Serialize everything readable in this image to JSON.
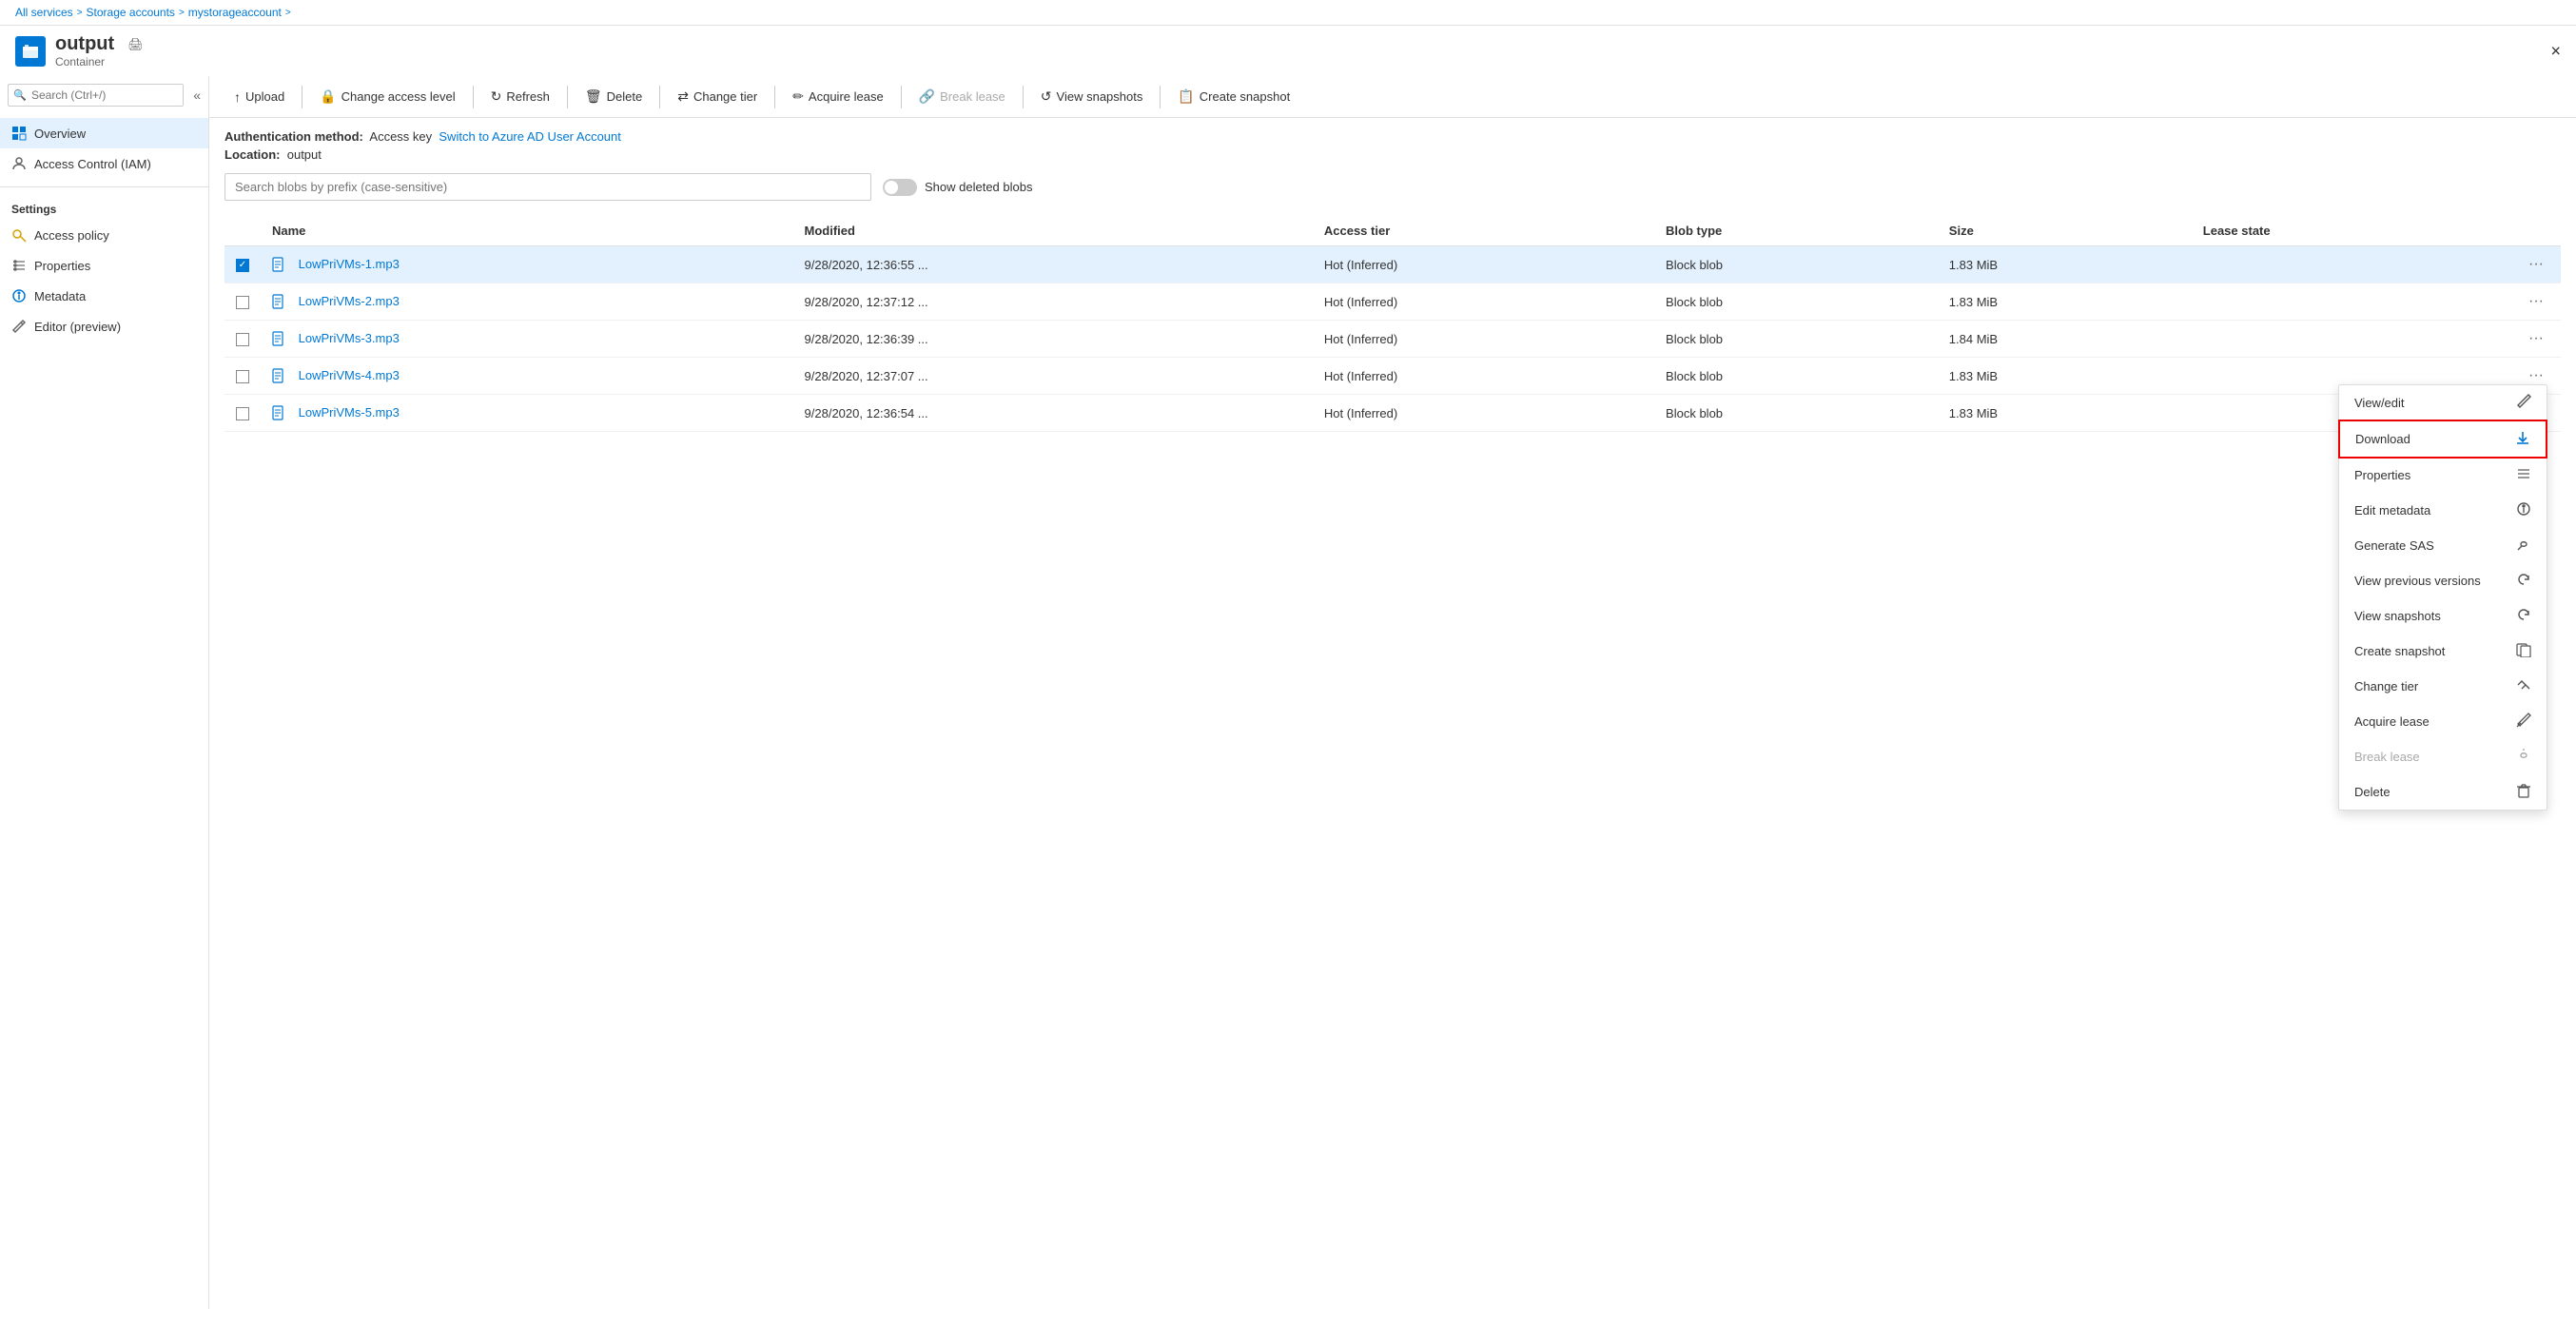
{
  "breadcrumb": {
    "items": [
      "All services",
      "Storage accounts",
      "mystorageaccount"
    ],
    "separators": [
      ">",
      ">",
      ">"
    ]
  },
  "header": {
    "title": "output",
    "subtitle": "Container",
    "close_label": "×"
  },
  "sidebar": {
    "search_placeholder": "Search (Ctrl+/)",
    "nav_items": [
      {
        "id": "overview",
        "label": "Overview",
        "active": true,
        "icon": "overview"
      },
      {
        "id": "access-control",
        "label": "Access Control (IAM)",
        "active": false,
        "icon": "iam"
      }
    ],
    "settings_label": "Settings",
    "settings_items": [
      {
        "id": "access-policy",
        "label": "Access policy",
        "icon": "key"
      },
      {
        "id": "properties",
        "label": "Properties",
        "icon": "properties"
      },
      {
        "id": "metadata",
        "label": "Metadata",
        "icon": "info"
      },
      {
        "id": "editor",
        "label": "Editor (preview)",
        "icon": "editor"
      }
    ]
  },
  "toolbar": {
    "buttons": [
      {
        "id": "upload",
        "label": "Upload",
        "icon": "↑",
        "disabled": false
      },
      {
        "id": "change-access",
        "label": "Change access level",
        "icon": "🔒",
        "disabled": false
      },
      {
        "id": "refresh",
        "label": "Refresh",
        "icon": "↻",
        "disabled": false
      },
      {
        "id": "delete",
        "label": "Delete",
        "icon": "🗑",
        "disabled": false
      },
      {
        "id": "change-tier",
        "label": "Change tier",
        "icon": "⇄",
        "disabled": false
      },
      {
        "id": "acquire-lease",
        "label": "Acquire lease",
        "icon": "✏",
        "disabled": false
      },
      {
        "id": "break-lease",
        "label": "Break lease",
        "icon": "🔗",
        "disabled": true
      },
      {
        "id": "view-snapshots",
        "label": "View snapshots",
        "icon": "↺",
        "disabled": false
      },
      {
        "id": "create-snapshot",
        "label": "Create snapshot",
        "icon": "📋",
        "disabled": false
      }
    ]
  },
  "auth": {
    "label": "Authentication method:",
    "method": "Access key",
    "link_text": "Switch to Azure AD User Account",
    "location_label": "Location:",
    "location_value": "output"
  },
  "search": {
    "placeholder": "Search blobs by prefix (case-sensitive)",
    "show_deleted_label": "Show deleted blobs"
  },
  "table": {
    "columns": [
      "",
      "Name",
      "Modified",
      "Access tier",
      "Blob type",
      "Size",
      "Lease state",
      ""
    ],
    "rows": [
      {
        "id": 1,
        "selected": true,
        "name": "LowPriVMs-1.mp3",
        "modified": "9/28/2020, 12:36:55 ...",
        "access_tier": "Hot (Inferred)",
        "blob_type": "Block blob",
        "size": "1.83 MiB",
        "lease_state": ""
      },
      {
        "id": 2,
        "selected": false,
        "name": "LowPriVMs-2.mp3",
        "modified": "9/28/2020, 12:37:12 ...",
        "access_tier": "Hot (Inferred)",
        "blob_type": "Block blob",
        "size": "1.83 MiB",
        "lease_state": ""
      },
      {
        "id": 3,
        "selected": false,
        "name": "LowPriVMs-3.mp3",
        "modified": "9/28/2020, 12:36:39 ...",
        "access_tier": "Hot (Inferred)",
        "blob_type": "Block blob",
        "size": "1.84 MiB",
        "lease_state": ""
      },
      {
        "id": 4,
        "selected": false,
        "name": "LowPriVMs-4.mp3",
        "modified": "9/28/2020, 12:37:07 ...",
        "access_tier": "Hot (Inferred)",
        "blob_type": "Block blob",
        "size": "1.83 MiB",
        "lease_state": ""
      },
      {
        "id": 5,
        "selected": false,
        "name": "LowPriVMs-5.mp3",
        "modified": "9/28/2020, 12:36:54 ...",
        "access_tier": "Hot (Inferred)",
        "blob_type": "Block blob",
        "size": "1.83 MiB",
        "lease_state": ""
      }
    ]
  },
  "context_menu": {
    "items": [
      {
        "id": "view-edit",
        "label": "View/edit",
        "icon": "✏",
        "disabled": false,
        "highlighted": false
      },
      {
        "id": "download",
        "label": "Download",
        "icon": "↓",
        "disabled": false,
        "highlighted": true
      },
      {
        "id": "properties",
        "label": "Properties",
        "icon": "≡",
        "disabled": false,
        "highlighted": false
      },
      {
        "id": "edit-metadata",
        "label": "Edit metadata",
        "icon": "ℹ",
        "disabled": false,
        "highlighted": false
      },
      {
        "id": "generate-sas",
        "label": "Generate SAS",
        "icon": "🔗",
        "disabled": false,
        "highlighted": false
      },
      {
        "id": "view-prev-versions",
        "label": "View previous versions",
        "icon": "↺",
        "disabled": false,
        "highlighted": false
      },
      {
        "id": "view-snapshots",
        "label": "View snapshots",
        "icon": "↺",
        "disabled": false,
        "highlighted": false
      },
      {
        "id": "create-snapshot",
        "label": "Create snapshot",
        "icon": "📋",
        "disabled": false,
        "highlighted": false
      },
      {
        "id": "change-tier",
        "label": "Change tier",
        "icon": "⇄",
        "disabled": false,
        "highlighted": false
      },
      {
        "id": "acquire-lease",
        "label": "Acquire lease",
        "icon": "✏",
        "disabled": false,
        "highlighted": false
      },
      {
        "id": "break-lease",
        "label": "Break lease",
        "icon": "🔗",
        "disabled": true,
        "highlighted": false
      },
      {
        "id": "delete",
        "label": "Delete",
        "icon": "🗑",
        "disabled": false,
        "highlighted": false
      }
    ]
  }
}
